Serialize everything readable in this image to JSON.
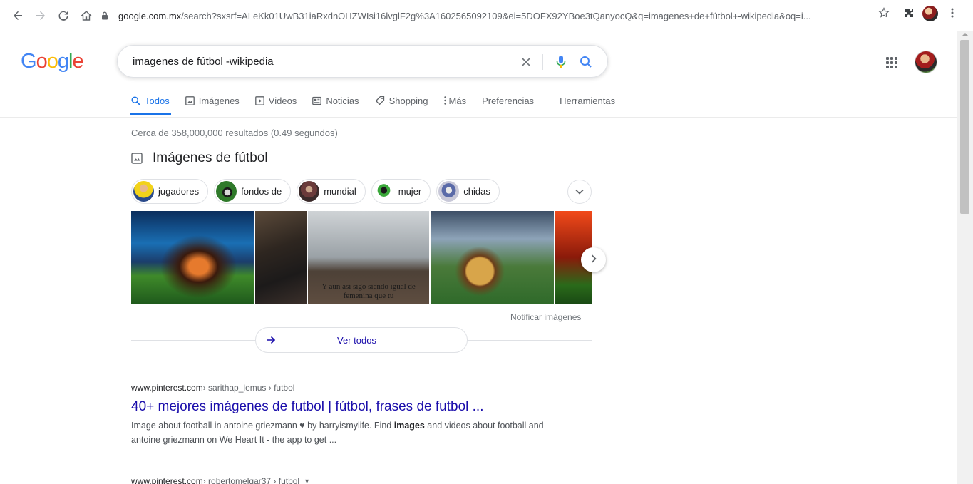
{
  "browser": {
    "url_host": "google.com.mx",
    "url_rest": "/search?sxsrf=ALeKk01UwB31iaRxdnOHZWIsi16lvglF2g%3A1602565092109&ei=5DOFX92YBoe3tQanyocQ&q=imagenes+de+fútbol+-wikipedia&oq=i..."
  },
  "logo": [
    "G",
    "o",
    "o",
    "g",
    "l",
    "e"
  ],
  "search": {
    "query": "imagenes de fútbol -wikipedia"
  },
  "tabs": [
    {
      "label": "Todos",
      "icon": "search-icon"
    },
    {
      "label": "Imágenes",
      "icon": "image-icon"
    },
    {
      "label": "Videos",
      "icon": "play-icon"
    },
    {
      "label": "Noticias",
      "icon": "news-icon"
    },
    {
      "label": "Shopping",
      "icon": "tag-icon"
    },
    {
      "label": "Más",
      "icon": "more-vert-icon"
    },
    {
      "label": "Preferencias",
      "icon": ""
    },
    {
      "label": "Herramientas",
      "icon": ""
    }
  ],
  "stats": "Cerca de 358,000,000 resultados (0.49 segundos)",
  "images": {
    "title": "Imágenes de fútbol",
    "chips": [
      "jugadores",
      "fondos de",
      "mundial",
      "mujer",
      "chidas"
    ],
    "caption": "Y aun asi sigo siendo igual de femenina que tu",
    "report": "Notificar imágenes",
    "see_all": "Ver todos"
  },
  "results": [
    {
      "cite_host": "www.pinterest.com",
      "cite_path": " › sarithap_lemus › futbol",
      "title": "40+ mejores imágenes de futbol | fútbol, frases de futbol ...",
      "snippet_a": "Image about football in antoine griezmann ♥ by harryismylife. Find ",
      "snippet_b": "images",
      "snippet_c": " and videos about football and antoine griezmann on We Heart It - the app to get ..."
    },
    {
      "cite_host": "www.pinterest.com",
      "cite_path": " › robertomelgar37 › futbol",
      "caret": "▼"
    }
  ],
  "colors": {
    "link": "#1a0dab",
    "accent": "#1a73e8",
    "muted": "#70757a"
  }
}
